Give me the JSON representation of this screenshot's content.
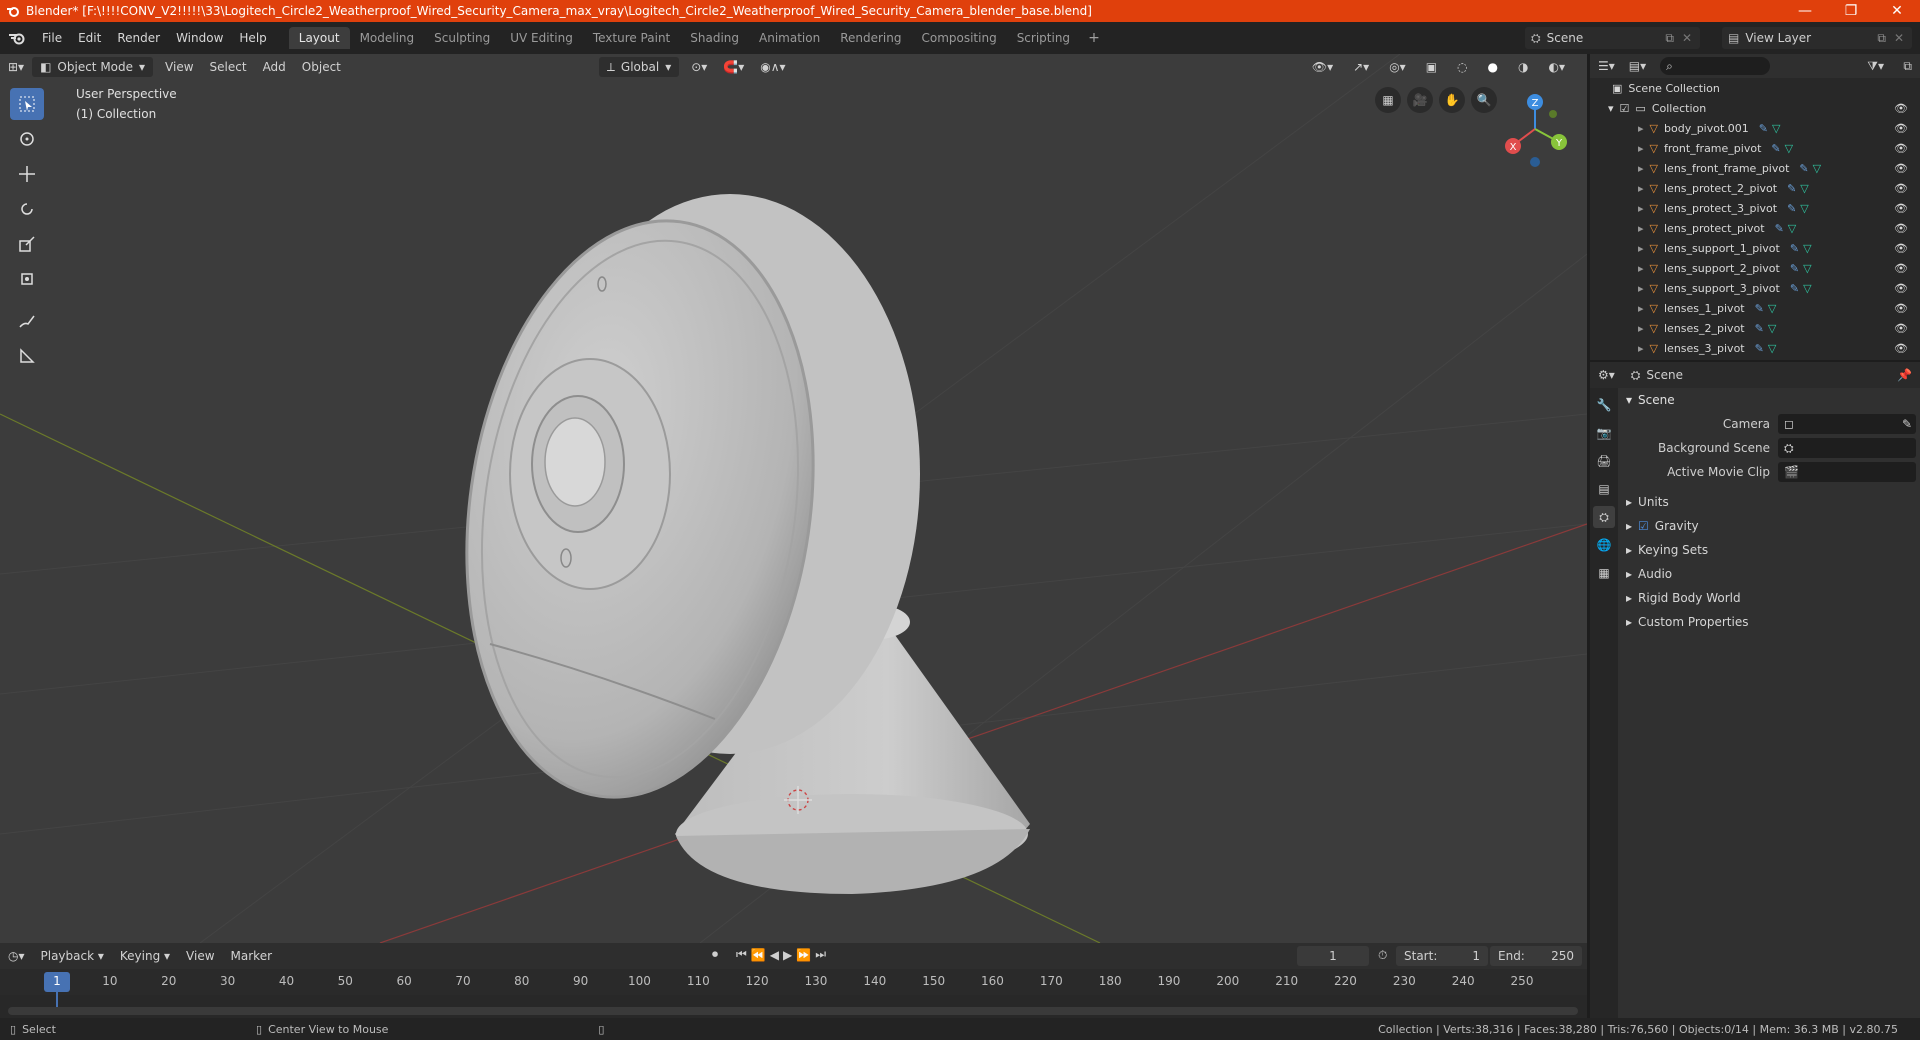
{
  "window": {
    "title": "Blender* [F:\\!!!!CONV_V2!!!!!\\33\\Logitech_Circle2_Weatherproof_Wired_Security_Camera_max_vray\\Logitech_Circle2_Weatherproof_Wired_Security_Camera_blender_base.blend]",
    "minimize": "—",
    "maximize": "❐",
    "close": "✕"
  },
  "menu": [
    "File",
    "Edit",
    "Render",
    "Window",
    "Help"
  ],
  "workspaces": [
    "Layout",
    "Modeling",
    "Sculpting",
    "UV Editing",
    "Texture Paint",
    "Shading",
    "Animation",
    "Rendering",
    "Compositing",
    "Scripting"
  ],
  "active_workspace": "Layout",
  "scene_name": "Scene",
  "view_layer": "View Layer",
  "viewport": {
    "mode": "Object Mode",
    "menus": [
      "View",
      "Select",
      "Add",
      "Object"
    ],
    "orientation": "Global",
    "perspective_label": "User Perspective",
    "collection_label": "(1) Collection",
    "gizmo": {
      "x": "X",
      "y": "Y",
      "z": "Z"
    }
  },
  "outliner": {
    "root": "Scene Collection",
    "collection": "Collection",
    "items": [
      "body_pivot.001",
      "front_frame_pivot",
      "lens_front_frame_pivot",
      "lens_protect_2_pivot",
      "lens_protect_3_pivot",
      "lens_protect_pivot",
      "lens_support_1_pivot",
      "lens_support_2_pivot",
      "lens_support_3_pivot",
      "lenses_1_pivot",
      "lenses_2_pivot",
      "lenses_3_pivot"
    ]
  },
  "properties": {
    "header": "Scene",
    "panel": "Scene",
    "fields": [
      {
        "label": "Camera",
        "value": ""
      },
      {
        "label": "Background Scene",
        "value": ""
      },
      {
        "label": "Active Movie Clip",
        "value": ""
      }
    ],
    "subpanels": [
      "Units",
      "Gravity",
      "Keying Sets",
      "Audio",
      "Rigid Body World",
      "Custom Properties"
    ],
    "gravity_checked": true
  },
  "timeline": {
    "menus": [
      "Playback",
      "Keying",
      "View",
      "Marker"
    ],
    "current_frame": "1",
    "start_label": "Start:",
    "start": "1",
    "end_label": "End:",
    "end": "250",
    "ticks": [
      "1",
      "10",
      "20",
      "30",
      "40",
      "50",
      "60",
      "70",
      "80",
      "90",
      "100",
      "110",
      "120",
      "130",
      "140",
      "150",
      "160",
      "170",
      "180",
      "190",
      "200",
      "210",
      "220",
      "230",
      "240",
      "250"
    ]
  },
  "statusbar": {
    "left": "Select",
    "middle": "Center View to Mouse",
    "stats": "Collection | Verts:38,316 | Faces:38,280 | Tris:76,560 | Objects:0/14 | Mem: 36.3 MB | v2.80.75"
  }
}
